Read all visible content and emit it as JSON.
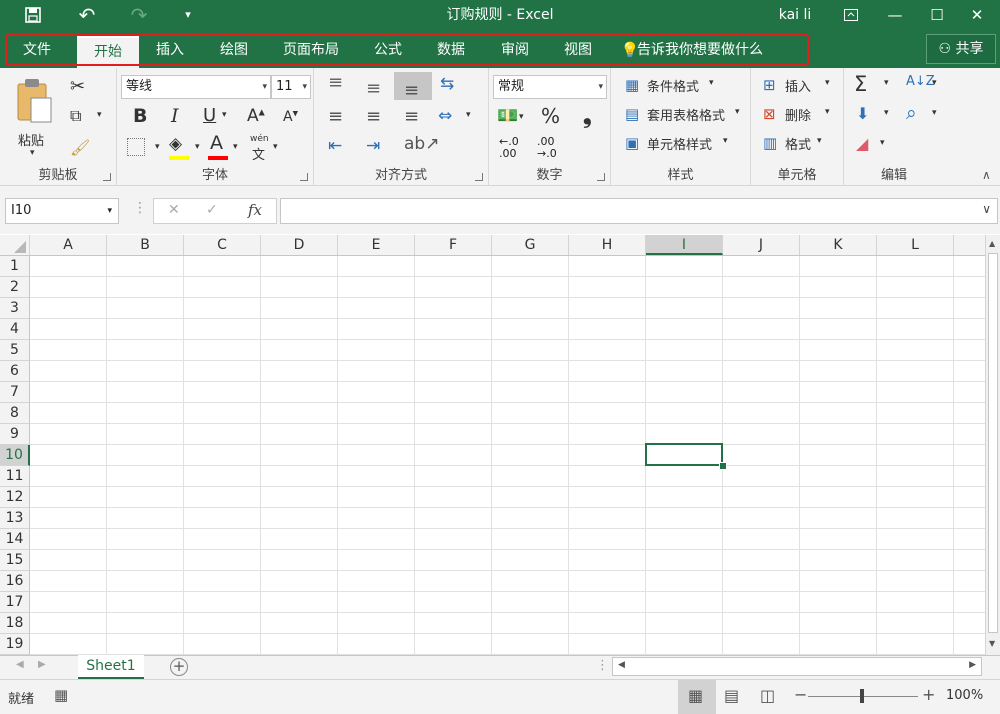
{
  "titlebar": {
    "title": "订购规则 - Excel",
    "user": "kai li",
    "save_icon": "💾",
    "undo_icon": "↶",
    "redo_icon": "↷",
    "customize_icon": "▾",
    "ribbon_display_icon": "⊡",
    "minimize_icon": "—",
    "maximize_icon": "☐",
    "close_icon": "✕"
  },
  "tabs": [
    "文件",
    "开始",
    "插入",
    "绘图",
    "页面布局",
    "公式",
    "数据",
    "审阅",
    "视图"
  ],
  "tell_me": "告诉我你想要做什么",
  "share_label": "共享",
  "ribbon": {
    "clipboard": {
      "label": "剪贴板",
      "paste": "粘贴"
    },
    "font": {
      "label": "字体",
      "font_name": "等线",
      "font_size": "11",
      "bold": "B",
      "italic": "I",
      "underline": "U",
      "grow": "A",
      "shrink": "A",
      "font_color": "A",
      "wen": "wén",
      "wen_char": "文"
    },
    "alignment": {
      "label": "对齐方式"
    },
    "number": {
      "label": "数字",
      "format": "常规",
      "percent": "%",
      "comma": "❟",
      "inc_top": "←.0",
      "inc_bottom": ".00",
      "dec_top": ".00",
      "dec_bottom": "→.0"
    },
    "styles": {
      "label": "样式",
      "conditional": "条件格式",
      "table": "套用表格格式",
      "cell_styles": "单元格样式"
    },
    "cells": {
      "label": "单元格",
      "insert": "插入",
      "delete": "删除",
      "format": "格式"
    },
    "editing": {
      "label": "编辑",
      "sum": "Σ",
      "sort": "A↓Z",
      "find": "⌕",
      "fill": "⬇",
      "clear": "◢"
    }
  },
  "formula_bar": {
    "name_box": "I10",
    "cancel": "✕",
    "enter": "✓",
    "fx": "fx",
    "value": ""
  },
  "columns": [
    "A",
    "B",
    "C",
    "D",
    "E",
    "F",
    "G",
    "H",
    "I",
    "J",
    "K",
    "L"
  ],
  "rows": [
    "1",
    "2",
    "3",
    "4",
    "5",
    "6",
    "7",
    "8",
    "9",
    "10",
    "11",
    "12",
    "13",
    "14",
    "15",
    "16",
    "17",
    "18",
    "19"
  ],
  "selected": {
    "column": "I",
    "row": "10"
  },
  "sheet": {
    "tab": "Sheet1",
    "add": "+"
  },
  "status": {
    "ready": "就绪",
    "zoom": "100%",
    "zoom_minus": "−",
    "zoom_plus": "+"
  },
  "colors": {
    "accent": "#217346",
    "highlight_box": "#e01e1e",
    "fill_yellow": "#ffff00",
    "font_red": "#ff0000"
  }
}
